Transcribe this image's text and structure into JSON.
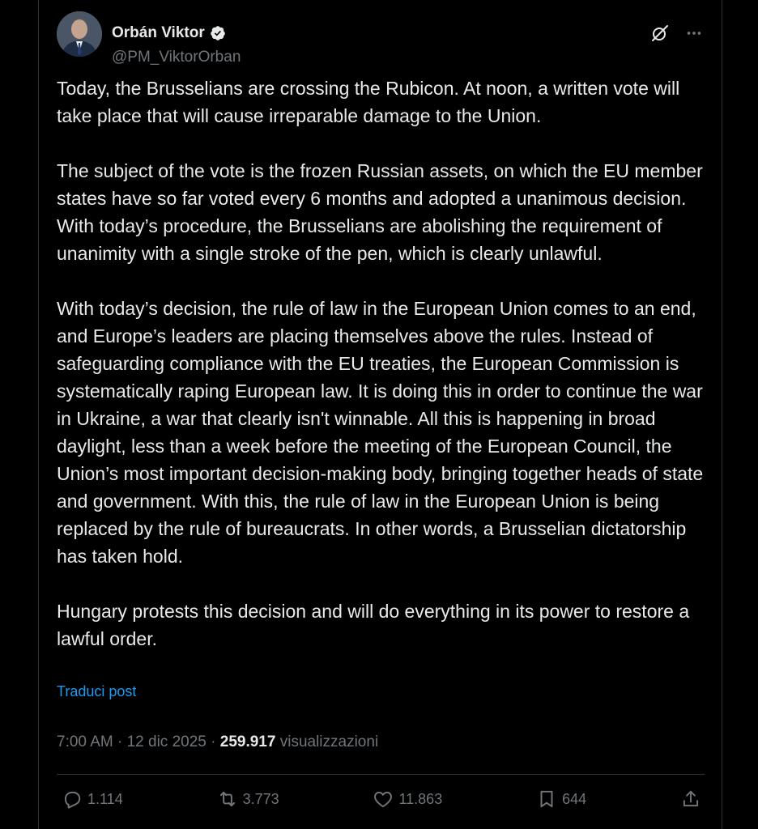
{
  "author": {
    "display_name": "Orbán Viktor",
    "handle": "@PM_ViktorOrban",
    "verified": true
  },
  "icons": {
    "verified": "verified-badge-icon",
    "grok": "grok-icon",
    "more": "more-icon",
    "reply": "reply-icon",
    "retweet": "retweet-icon",
    "like": "like-icon",
    "bookmark": "bookmark-icon",
    "share": "share-icon"
  },
  "colors": {
    "background": "#000000",
    "text": "#e7e9ea",
    "secondary": "#71767b",
    "link": "#1d9bf0",
    "verified": "#1d9bf0",
    "divider": "#2f3336"
  },
  "post": {
    "paragraphs": [
      "Today, the Brusselians are crossing the Rubicon. At noon, a written vote will take place that will cause irreparable damage to the Union.",
      "The subject of the vote is the frozen Russian assets, on which the EU member states have so far voted every 6 months and adopted a unanimous decision. With today’s procedure, the Brusselians are abolishing the requirement of unanimity with a single stroke of the pen, which is clearly unlawful.",
      "With today’s decision, the rule of law in the European Union comes to an end, and Europe’s leaders are placing themselves above the rules. Instead of safeguarding compliance with the EU treaties, the European Commission is systematically raping European law. It is doing this in order to continue the war in Ukraine, a war that clearly isn't winnable. All this is happening in broad daylight, less than a week before the meeting of the European Council, the Union’s most important decision-making body, bringing together heads of state and government. With this, the rule of law in the European Union is being replaced by the rule of bureaucrats. In other words, a Brusselian dictatorship has taken hold.",
      "Hungary protests this decision and will do everything in its power to restore a lawful order."
    ],
    "translate_label": "Traduci post"
  },
  "meta": {
    "time": "7:00 AM",
    "separator": "·",
    "date": "12 dic 2025",
    "views_count": "259.917",
    "views_label": "visualizzazioni"
  },
  "actions": {
    "replies": "1.114",
    "retweets": "3.773",
    "likes": "11.863",
    "bookmarks": "644"
  }
}
